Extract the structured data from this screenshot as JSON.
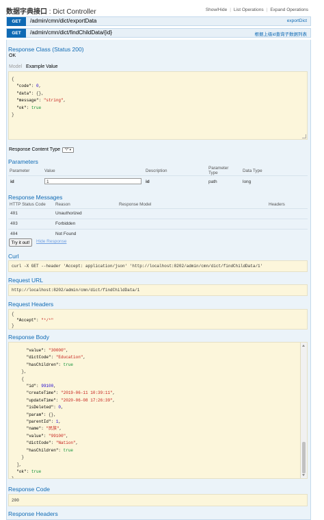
{
  "header": {
    "title_bold": "数据字典接口",
    "title_rest": " : Dict Controller"
  },
  "toplinks": {
    "show_hide": "Show/Hide",
    "list_ops": "List Operations",
    "expand_ops": "Expand Operations"
  },
  "op1": {
    "method": "GET",
    "path": "/admin/cmn/dict/exportData",
    "summary": "exportDict"
  },
  "op2": {
    "method": "GET",
    "path": "/admin/cmn/dict/findChildData/{id}",
    "summary": "根据上级id查询子数据列表"
  },
  "response_class": {
    "heading": "Response Class (Status 200)",
    "status": "OK",
    "tab_model": "Model",
    "tab_example": "Example Value"
  },
  "example_value": [
    "{",
    "  \"code\": 0,",
    "  \"data\": {},",
    "  \"message\": \"string\",",
    "  \"ok\": true",
    "}"
  ],
  "content_type": {
    "label": "Response Content Type",
    "value": "*/*"
  },
  "parameters": {
    "heading": "Parameters",
    "headers": {
      "parameter": "Parameter",
      "value": "Value",
      "description": "Description",
      "param_type": "Parameter Type",
      "data_type": "Data Type"
    },
    "row": {
      "name": "id",
      "value": "1",
      "description": "id",
      "param_type": "path",
      "data_type": "long"
    }
  },
  "messages": {
    "heading": "Response Messages",
    "headers": {
      "code": "HTTP Status Code",
      "reason": "Reason",
      "model": "Response Model",
      "headers": "Headers"
    },
    "rows": [
      {
        "code": "401",
        "reason": "Unauthorized"
      },
      {
        "code": "403",
        "reason": "Forbidden"
      },
      {
        "code": "404",
        "reason": "Not Found"
      }
    ]
  },
  "actions": {
    "try": "Try it out!",
    "hide": "Hide Response"
  },
  "curl": {
    "heading": "Curl",
    "text": "curl -X GET --header 'Accept: application/json' 'http://localhost:8202/admin/cmn/dict/findChildData/1'"
  },
  "request_url": {
    "heading": "Request URL",
    "text": "http://localhost:8202/admin/cmn/dict/findChildData/1"
  },
  "request_headers": {
    "heading": "Request Headers",
    "lines": [
      "{",
      "  \"Accept\": \"*/*\"",
      "}"
    ]
  },
  "response_body": {
    "heading": "Response Body",
    "lines": [
      "      \"value\": \"30000\",",
      "      \"dictCode\": \"Education\",",
      "      \"hasChildren\": true",
      "    },",
      "    {",
      "      \"id\": 99100,",
      "      \"createTime\": \"2019-06-11 10:39:11\",",
      "      \"updateTime\": \"2020-06-08 17:26:39\",",
      "      \"isDeleted\": 0,",
      "      \"param\": {},",
      "      \"parentId\": 1,",
      "      \"name\": \"民族\",",
      "      \"value\": \"99100\",",
      "      \"dictCode\": \"Nation\",",
      "      \"hasChildren\": true",
      "    }",
      "  ],",
      "  \"ok\": true",
      "}"
    ]
  },
  "response_code": {
    "heading": "Response Code",
    "value": "200"
  },
  "response_headers": {
    "heading": "Response Headers"
  }
}
